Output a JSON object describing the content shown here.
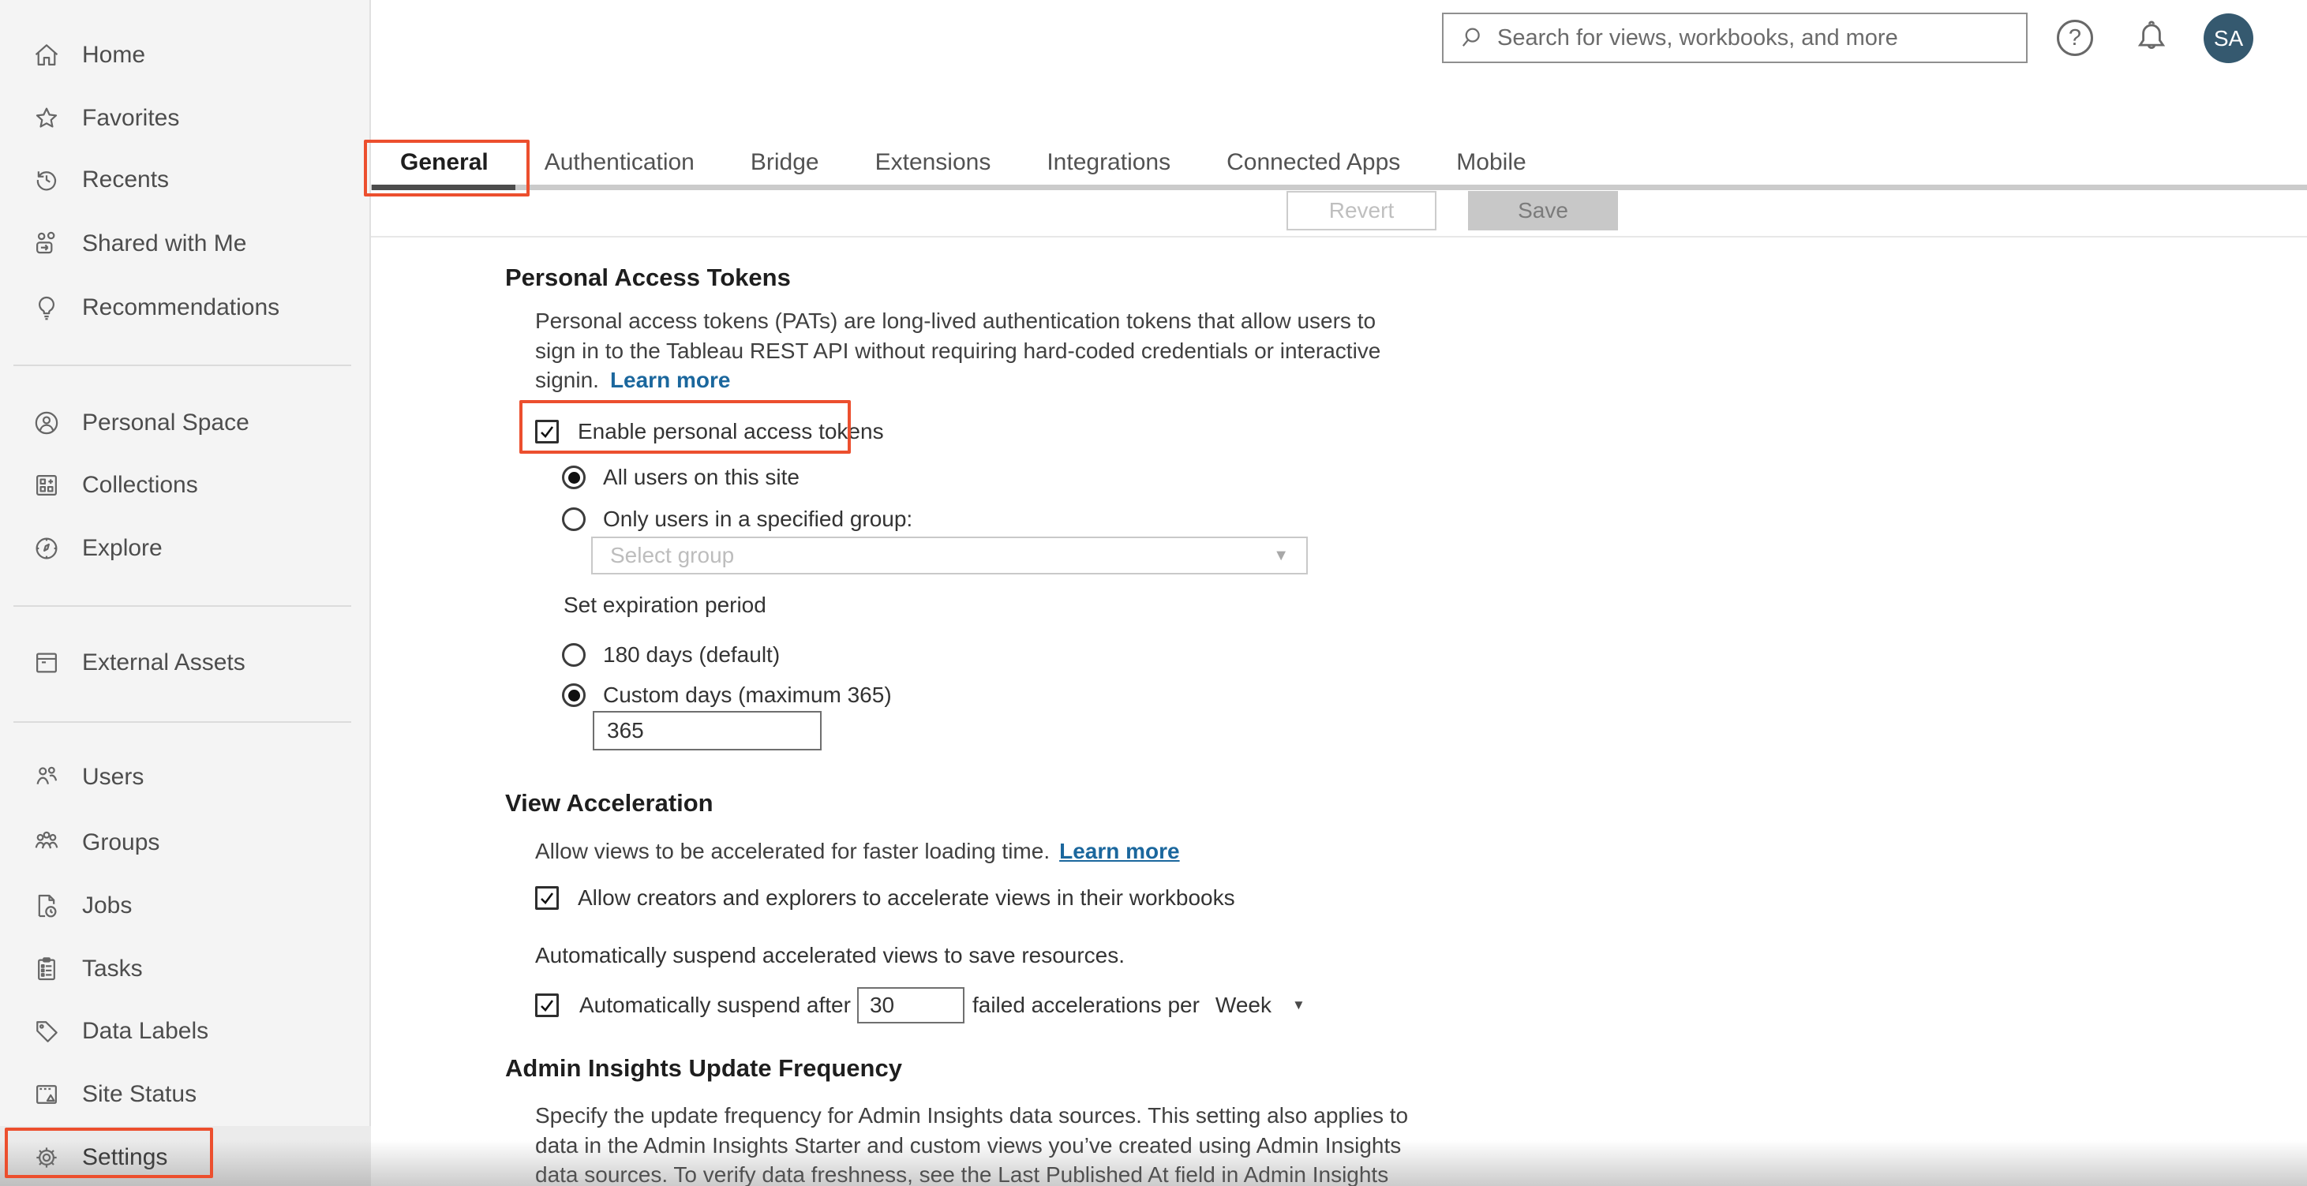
{
  "colors": {
    "annotation": "#EC4F2E",
    "link": "#1B679D",
    "avatar": "#35596F"
  },
  "icons": {
    "dropdown_arrow": "▼"
  },
  "header": {
    "search_placeholder": "Search for views, workbooks, and more",
    "avatar_initials": "SA"
  },
  "sidebar": {
    "items": [
      {
        "label": "Home",
        "icon": "home-icon"
      },
      {
        "label": "Favorites",
        "icon": "star-icon"
      },
      {
        "label": "Recents",
        "icon": "clock-history-icon"
      },
      {
        "label": "Shared with Me",
        "icon": "shared-with-me-icon"
      },
      {
        "label": "Recommendations",
        "icon": "lightbulb-icon"
      },
      {
        "label": "Personal Space",
        "icon": "person-circle-icon"
      },
      {
        "label": "Collections",
        "icon": "collections-grid-icon"
      },
      {
        "label": "Explore",
        "icon": "compass-icon"
      },
      {
        "label": "External Assets",
        "icon": "archive-box-icon"
      },
      {
        "label": "Users",
        "icon": "users-icon"
      },
      {
        "label": "Groups",
        "icon": "groups-icon"
      },
      {
        "label": "Jobs",
        "icon": "document-clock-icon"
      },
      {
        "label": "Tasks",
        "icon": "clipboard-list-icon"
      },
      {
        "label": "Data Labels",
        "icon": "tag-icon"
      },
      {
        "label": "Site Status",
        "icon": "site-status-window-icon"
      },
      {
        "label": "Settings",
        "icon": "gear-icon"
      }
    ]
  },
  "tabs": [
    {
      "label": "General"
    },
    {
      "label": "Authentication"
    },
    {
      "label": "Bridge"
    },
    {
      "label": "Extensions"
    },
    {
      "label": "Integrations"
    },
    {
      "label": "Connected Apps"
    },
    {
      "label": "Mobile"
    }
  ],
  "toolbar": {
    "revert": "Revert",
    "save": "Save"
  },
  "pat": {
    "title": "Personal Access Tokens",
    "desc": [
      "Personal access tokens (PATs) are long-lived authentication tokens that allow users to",
      "sign in to the Tableau REST API without requiring hard-coded credentials or interactive",
      "signin."
    ],
    "learn_more": "Learn more",
    "enable_label": "Enable personal access tokens",
    "all_users": "All users on this site",
    "group_users": "Only users in a specified group:",
    "select_placeholder": "Select group",
    "expiration": "Set expiration period",
    "d180": "180 days (default)",
    "custom": "Custom days (maximum 365)",
    "custom_value": "365"
  },
  "va": {
    "title": "View Acceleration",
    "desc": "Allow views to be accelerated for faster loading time.",
    "learn_more": "Learn more",
    "allow_label": "Allow creators and explorers to accelerate views in their workbooks",
    "suspend_note": "Automatically suspend accelerated views to save resources.",
    "suspend_prefix": "Automatically suspend after",
    "suspend_value": "30",
    "suspend_suffix": "failed accelerations per",
    "period": "Week"
  },
  "admin": {
    "title": "Admin Insights Update Frequency",
    "desc": [
      "Specify the update frequency for Admin Insights data sources. This setting also applies to",
      "data in the Admin Insights Starter and custom views you’ve created using Admin Insights",
      "data sources. To verify data freshness, see the Last Published At field in Admin Insights"
    ]
  }
}
